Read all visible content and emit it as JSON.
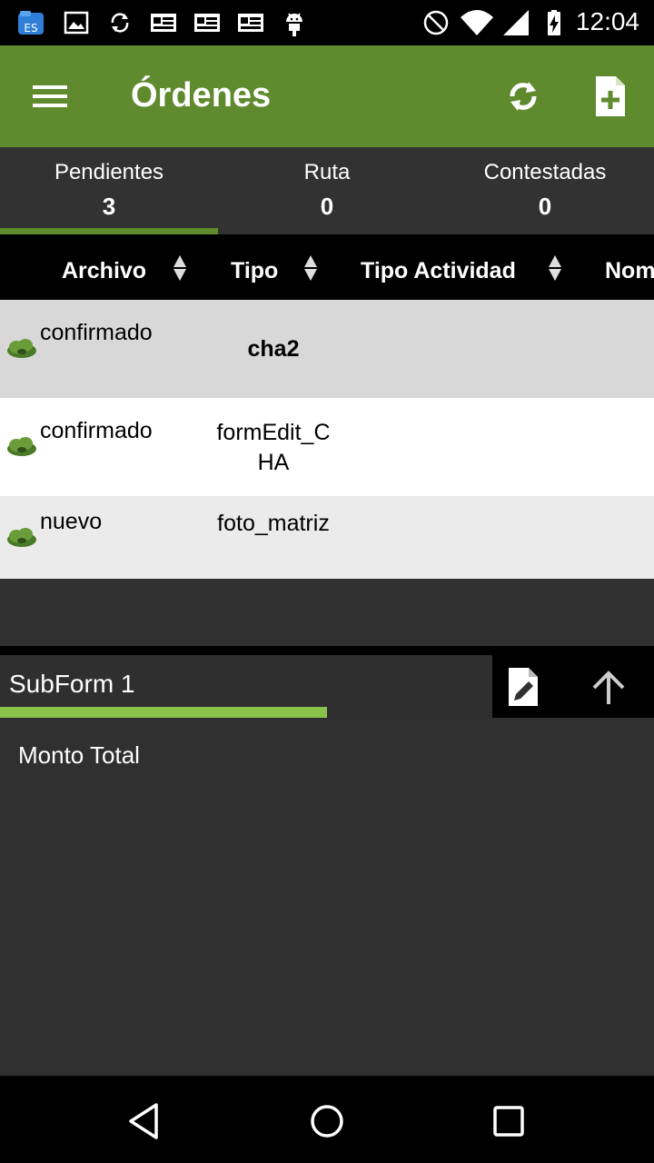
{
  "status_bar": {
    "time": "12:04",
    "icons": [
      "file-manager-icon",
      "image-icon",
      "sync-icon",
      "news-icon",
      "news-icon",
      "news-icon",
      "android-icon",
      "do-not-disturb-icon",
      "wifi-icon",
      "battery-charging-icon"
    ]
  },
  "app_bar": {
    "title": "Órdenes",
    "icons": [
      "menu-icon",
      "refresh-icon",
      "new-document-icon"
    ],
    "color": "#5f8a2e"
  },
  "tabs": [
    {
      "label": "Pendientes",
      "count": "3",
      "selected": true
    },
    {
      "label": "Ruta",
      "count": "0",
      "selected": false
    },
    {
      "label": "Contestadas",
      "count": "0",
      "selected": false
    }
  ],
  "table": {
    "columns": [
      "Archivo",
      "Tipo",
      "Tipo Actividad",
      "Nom"
    ],
    "rows": [
      {
        "status": "confirmado",
        "tipo": "cha2",
        "bold": true
      },
      {
        "status": "confirmado",
        "tipo": "formEdit_CHA",
        "bold": false
      },
      {
        "status": "nuevo",
        "tipo": "foto_matriz",
        "bold": false
      }
    ]
  },
  "subform": {
    "tab_label": "SubForm 1",
    "accent": "#8bc34a",
    "fields": [
      "Monto Total"
    ]
  }
}
